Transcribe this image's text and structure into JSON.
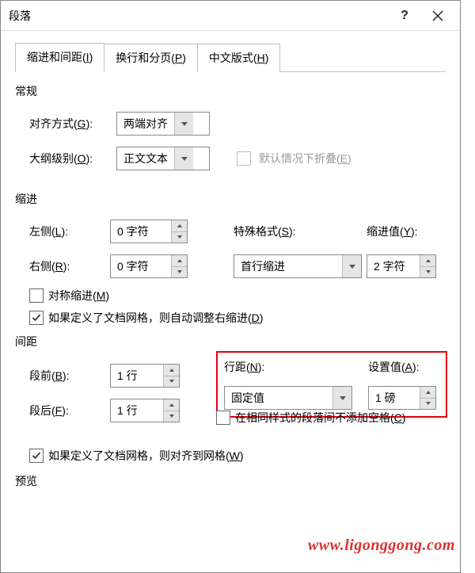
{
  "window": {
    "title": "段落",
    "help": "?"
  },
  "tabs": [
    {
      "label_pre": "缩进和间距(",
      "hotkey": "I"
    },
    {
      "label_pre": "换行和分页(",
      "hotkey": "P"
    },
    {
      "label_pre": "中文版式(",
      "hotkey": "H"
    }
  ],
  "sections": {
    "general": "常规",
    "indent": "缩进",
    "spacing": "间距",
    "preview": "预览"
  },
  "general": {
    "alignment": {
      "label_pre": "对齐方式(",
      "hotkey": "G",
      "value": "两端对齐"
    },
    "outline": {
      "label_pre": "大纲级别(",
      "hotkey": "O",
      "value": "正文文本"
    },
    "collapsed": {
      "label_pre": "默认情况下折叠(",
      "hotkey": "E",
      "checked": false,
      "enabled": false
    }
  },
  "indent": {
    "left": {
      "label_pre": "左侧(",
      "hotkey": "L",
      "value": "0 字符"
    },
    "right": {
      "label_pre": "右侧(",
      "hotkey": "R",
      "value": "0 字符"
    },
    "special": {
      "label_pre": "特殊格式(",
      "hotkey": "S",
      "value": "首行缩进"
    },
    "by": {
      "label_pre": "缩进值(",
      "hotkey": "Y",
      "value": "2 字符"
    },
    "mirror": {
      "label_pre": "对称缩进(",
      "hotkey": "M",
      "checked": false
    },
    "grid_adjust": {
      "label_pre": "如果定义了文档网格，则自动调整右缩进(",
      "hotkey": "D",
      "checked": true
    }
  },
  "spacing": {
    "before": {
      "label_pre": "段前(",
      "hotkey": "B",
      "value": "1 行"
    },
    "after": {
      "label_pre": "段后(",
      "hotkey": "F",
      "value": "1 行"
    },
    "line": {
      "label_pre": "行距(",
      "hotkey": "N",
      "value": "固定值"
    },
    "at": {
      "label_pre": "设置值(",
      "hotkey": "A",
      "value": "1 磅"
    },
    "nospace": {
      "label_pre": "在相同样式的段落间不添加空格(",
      "hotkey": "C",
      "checked": false
    },
    "snapgrid": {
      "label_pre": "如果定义了文档网格，则对齐到网格(",
      "hotkey": "W",
      "checked": true
    }
  },
  "watermark": "www.ligonggong.com"
}
